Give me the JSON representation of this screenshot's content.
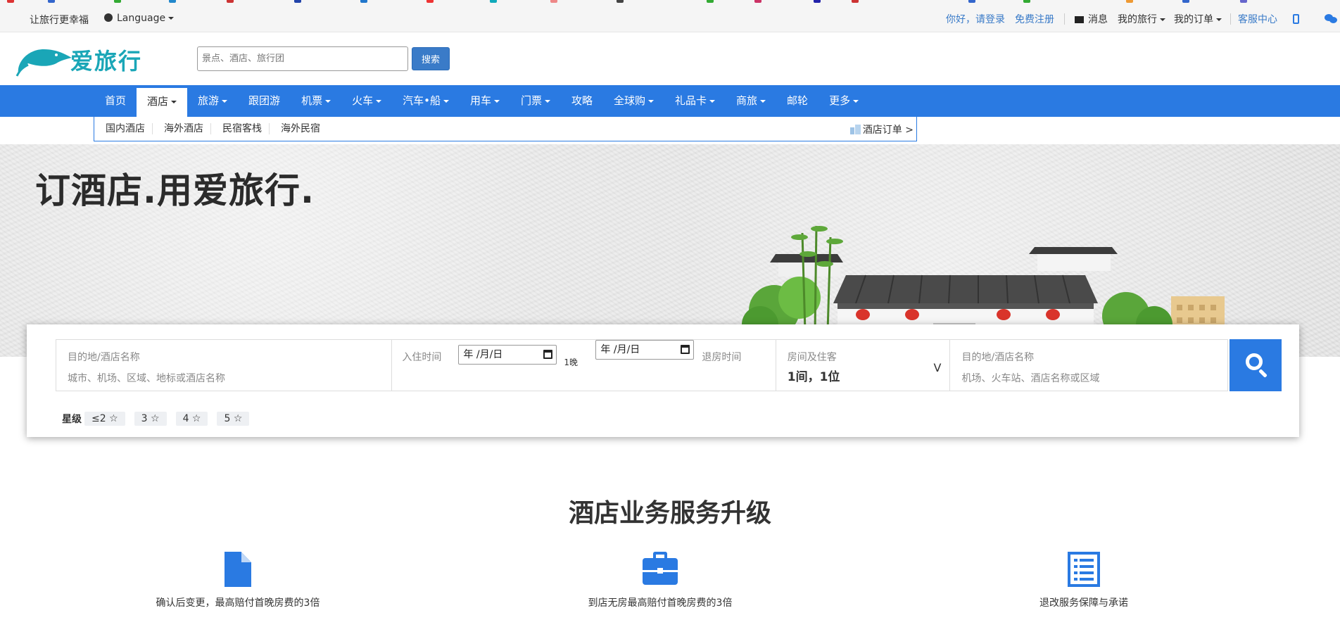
{
  "topbar": {
    "slogan": "让旅行更幸福",
    "language_label": "Language",
    "login_link": "你好，请登录",
    "register_link": "免费注册",
    "messages_label": "消息",
    "my_trips_label": "我的旅行",
    "my_orders_label": "我的订单",
    "service_center_label": "客服中心"
  },
  "header": {
    "logo_text": "爱旅行",
    "search_placeholder": "景点、酒店、旅行团",
    "search_button": "搜索"
  },
  "nav": {
    "items": [
      {
        "label": "首页",
        "dropdown": false
      },
      {
        "label": "酒店",
        "dropdown": true,
        "active": true
      },
      {
        "label": "旅游",
        "dropdown": true
      },
      {
        "label": "跟团游",
        "dropdown": false
      },
      {
        "label": "机票",
        "dropdown": true
      },
      {
        "label": "火车",
        "dropdown": true
      },
      {
        "label": "汽车•船",
        "dropdown": true
      },
      {
        "label": "用车",
        "dropdown": true
      },
      {
        "label": "门票",
        "dropdown": true
      },
      {
        "label": "攻略",
        "dropdown": false
      },
      {
        "label": "全球购",
        "dropdown": true
      },
      {
        "label": "礼品卡",
        "dropdown": true
      },
      {
        "label": "商旅",
        "dropdown": true
      },
      {
        "label": "邮轮",
        "dropdown": false
      },
      {
        "label": "更多",
        "dropdown": true
      }
    ]
  },
  "subnav": {
    "items": [
      "国内酒店",
      "海外酒店",
      "民宿客栈",
      "海外民宿"
    ],
    "hotel_orders": "酒店订单 >"
  },
  "banner": {
    "title": "订酒店.用爱旅行."
  },
  "search_panel": {
    "destination_label": "目的地/酒店名称",
    "destination_placeholder": "城市、机场、区域、地标或酒店名称",
    "checkin_label": "入住时间",
    "checkin_value": "年 /月/日",
    "nights": "1晚",
    "checkout_value": "年 /月/日",
    "checkout_label": "退房时间",
    "rooms_label": "房间及住客",
    "rooms_value": "1间，1位",
    "rooms_chevron": "V",
    "keyword_label": "目的地/酒店名称",
    "keyword_placeholder": "机场、火车站、酒店名称或区域",
    "star_label": "星级",
    "star_options": [
      "≤2 ☆",
      "3 ☆",
      "4 ☆",
      "5 ☆"
    ]
  },
  "features": {
    "title": "酒店业务服务升级",
    "items": [
      {
        "icon": "document-icon",
        "text": "确认后变更，最高赔付首晚房费的3倍"
      },
      {
        "icon": "briefcase-icon",
        "text": "到店无房最高赔付首晚房费的3倍"
      },
      {
        "icon": "list-icon",
        "text": "退改服务保障与承诺"
      }
    ]
  },
  "colors": {
    "brand_blue": "#2a7ae2",
    "link_blue": "#3a7bc8",
    "logo_teal": "#1aa6b7"
  }
}
